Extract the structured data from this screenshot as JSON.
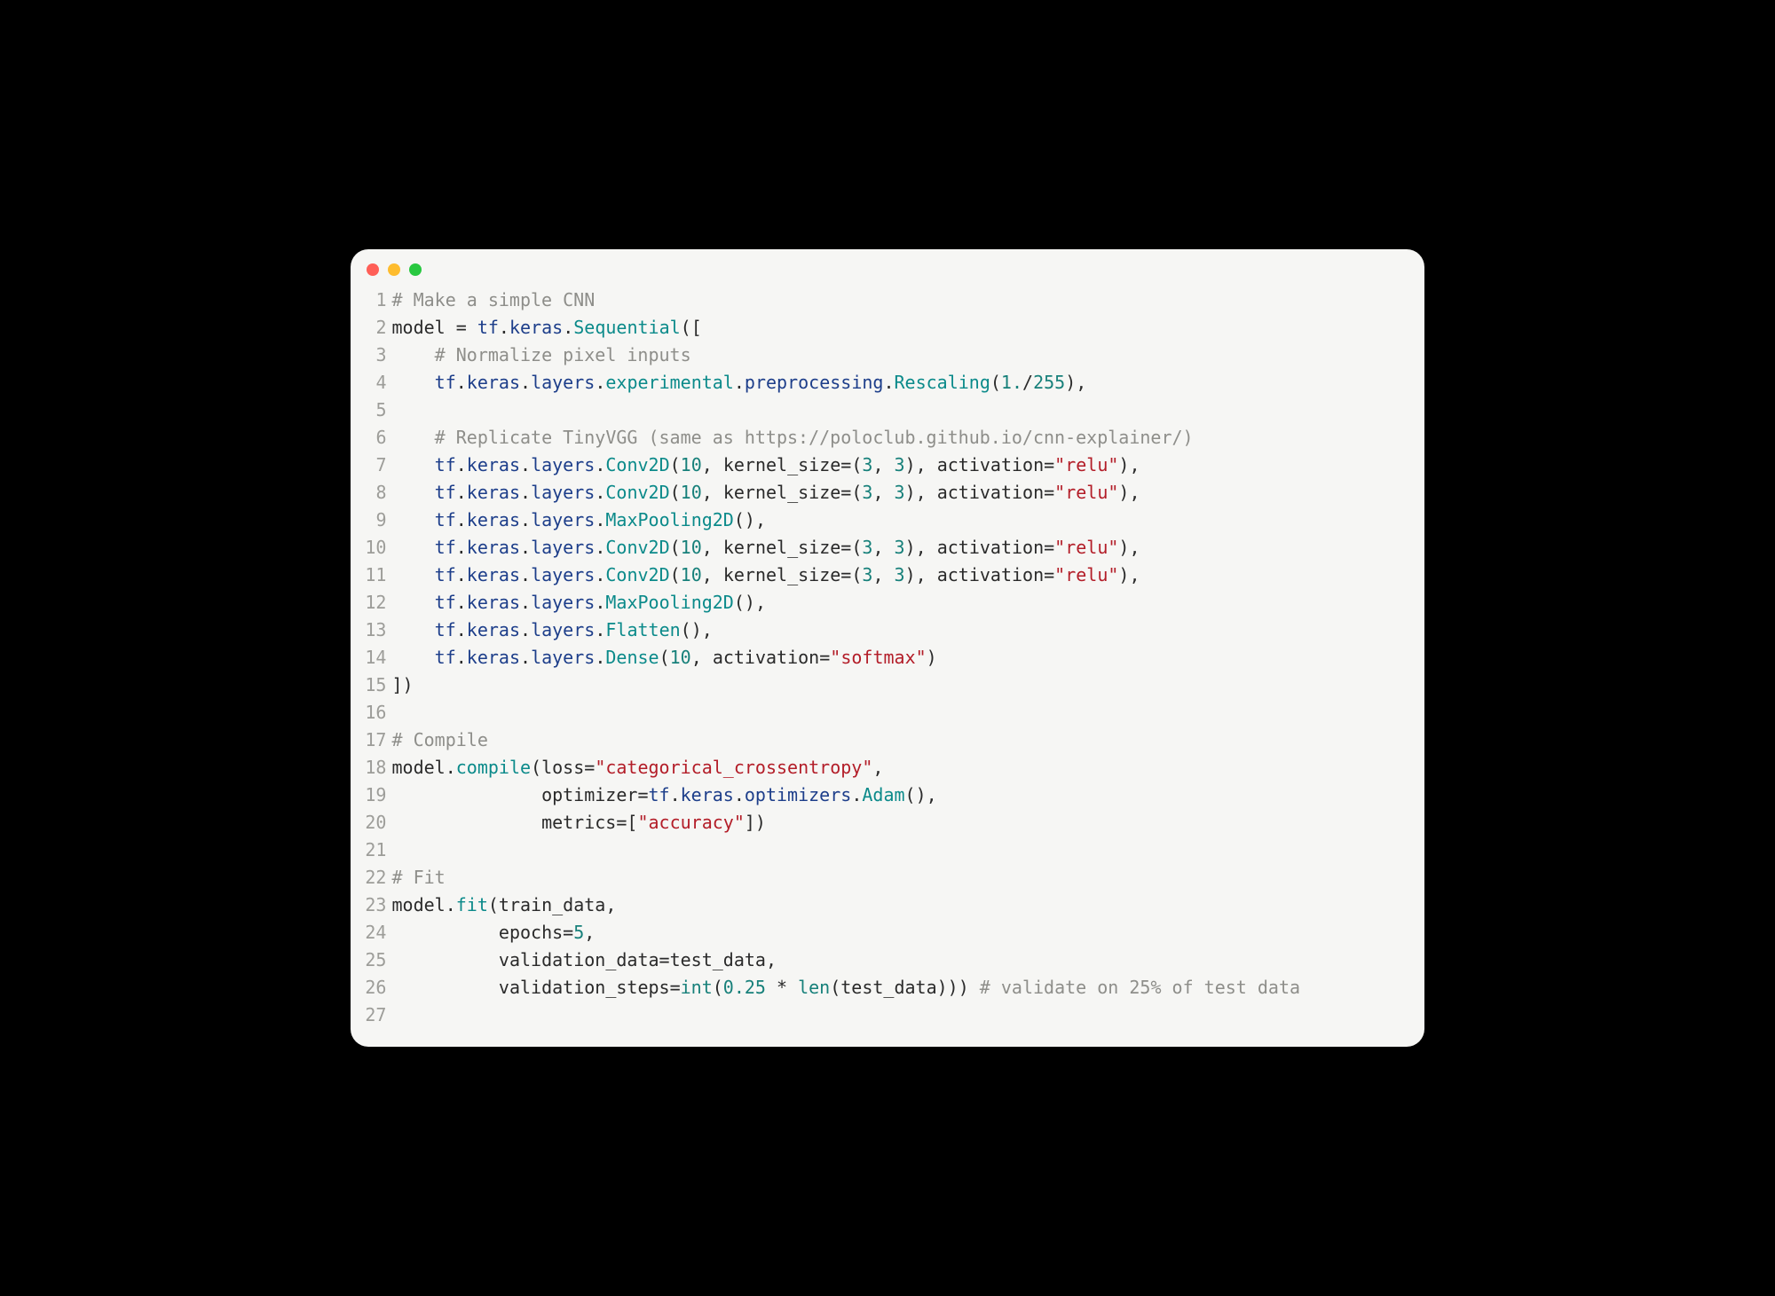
{
  "colors": {
    "background_page": "#000000",
    "window_background": "#f6f6f4",
    "gutter": "#9d9d99",
    "comment": "#8e8e8a",
    "keyword_blue": "#1d3e8a",
    "method_teal": "#0b8a8a",
    "number_teal": "#17807a",
    "string_red": "#b31d28",
    "text": "#2a2a2a",
    "dot_red": "#ff5f57",
    "dot_yellow": "#febc2e",
    "dot_green": "#28c840"
  },
  "titlebar": {
    "dots": [
      "red",
      "yellow",
      "green"
    ]
  },
  "code_lines": [
    {
      "n": 1,
      "tokens": [
        {
          "cls": "c-comment",
          "t": "# Make a simple CNN"
        }
      ]
    },
    {
      "n": 2,
      "tokens": [
        {
          "cls": "c-id",
          "t": "model "
        },
        {
          "cls": "c-op",
          "t": "= "
        },
        {
          "cls": "c-kw",
          "t": "tf"
        },
        {
          "cls": "c-punc",
          "t": "."
        },
        {
          "cls": "c-kw",
          "t": "keras"
        },
        {
          "cls": "c-punc",
          "t": "."
        },
        {
          "cls": "c-func",
          "t": "Sequential"
        },
        {
          "cls": "c-punc",
          "t": "(["
        }
      ]
    },
    {
      "n": 3,
      "tokens": [
        {
          "cls": "c-id",
          "t": "    "
        },
        {
          "cls": "c-comment",
          "t": "# Normalize pixel inputs"
        }
      ]
    },
    {
      "n": 4,
      "tokens": [
        {
          "cls": "c-id",
          "t": "    "
        },
        {
          "cls": "c-kw",
          "t": "tf"
        },
        {
          "cls": "c-punc",
          "t": "."
        },
        {
          "cls": "c-kw",
          "t": "keras"
        },
        {
          "cls": "c-punc",
          "t": "."
        },
        {
          "cls": "c-kw",
          "t": "layers"
        },
        {
          "cls": "c-punc",
          "t": "."
        },
        {
          "cls": "c-func",
          "t": "experimental"
        },
        {
          "cls": "c-punc",
          "t": "."
        },
        {
          "cls": "c-kw",
          "t": "preprocessing"
        },
        {
          "cls": "c-punc",
          "t": "."
        },
        {
          "cls": "c-func",
          "t": "Rescaling"
        },
        {
          "cls": "c-punc",
          "t": "("
        },
        {
          "cls": "c-num",
          "t": "1."
        },
        {
          "cls": "c-op",
          "t": "/"
        },
        {
          "cls": "c-num",
          "t": "255"
        },
        {
          "cls": "c-punc",
          "t": "),"
        }
      ]
    },
    {
      "n": 5,
      "tokens": [
        {
          "cls": "c-id",
          "t": ""
        }
      ]
    },
    {
      "n": 6,
      "tokens": [
        {
          "cls": "c-id",
          "t": "    "
        },
        {
          "cls": "c-comment",
          "t": "# Replicate TinyVGG (same as https://poloclub.github.io/cnn-explainer/)"
        }
      ]
    },
    {
      "n": 7,
      "tokens": [
        {
          "cls": "c-id",
          "t": "    "
        },
        {
          "cls": "c-kw",
          "t": "tf"
        },
        {
          "cls": "c-punc",
          "t": "."
        },
        {
          "cls": "c-kw",
          "t": "keras"
        },
        {
          "cls": "c-punc",
          "t": "."
        },
        {
          "cls": "c-kw",
          "t": "layers"
        },
        {
          "cls": "c-punc",
          "t": "."
        },
        {
          "cls": "c-func",
          "t": "Conv2D"
        },
        {
          "cls": "c-punc",
          "t": "("
        },
        {
          "cls": "c-num",
          "t": "10"
        },
        {
          "cls": "c-punc",
          "t": ", "
        },
        {
          "cls": "c-param",
          "t": "kernel_size"
        },
        {
          "cls": "c-op",
          "t": "="
        },
        {
          "cls": "c-punc",
          "t": "("
        },
        {
          "cls": "c-num",
          "t": "3"
        },
        {
          "cls": "c-punc",
          "t": ", "
        },
        {
          "cls": "c-num",
          "t": "3"
        },
        {
          "cls": "c-punc",
          "t": "), "
        },
        {
          "cls": "c-param",
          "t": "activation"
        },
        {
          "cls": "c-op",
          "t": "="
        },
        {
          "cls": "c-str",
          "t": "\"relu\""
        },
        {
          "cls": "c-punc",
          "t": "),"
        }
      ]
    },
    {
      "n": 8,
      "tokens": [
        {
          "cls": "c-id",
          "t": "    "
        },
        {
          "cls": "c-kw",
          "t": "tf"
        },
        {
          "cls": "c-punc",
          "t": "."
        },
        {
          "cls": "c-kw",
          "t": "keras"
        },
        {
          "cls": "c-punc",
          "t": "."
        },
        {
          "cls": "c-kw",
          "t": "layers"
        },
        {
          "cls": "c-punc",
          "t": "."
        },
        {
          "cls": "c-func",
          "t": "Conv2D"
        },
        {
          "cls": "c-punc",
          "t": "("
        },
        {
          "cls": "c-num",
          "t": "10"
        },
        {
          "cls": "c-punc",
          "t": ", "
        },
        {
          "cls": "c-param",
          "t": "kernel_size"
        },
        {
          "cls": "c-op",
          "t": "="
        },
        {
          "cls": "c-punc",
          "t": "("
        },
        {
          "cls": "c-num",
          "t": "3"
        },
        {
          "cls": "c-punc",
          "t": ", "
        },
        {
          "cls": "c-num",
          "t": "3"
        },
        {
          "cls": "c-punc",
          "t": "), "
        },
        {
          "cls": "c-param",
          "t": "activation"
        },
        {
          "cls": "c-op",
          "t": "="
        },
        {
          "cls": "c-str",
          "t": "\"relu\""
        },
        {
          "cls": "c-punc",
          "t": "),"
        }
      ]
    },
    {
      "n": 9,
      "tokens": [
        {
          "cls": "c-id",
          "t": "    "
        },
        {
          "cls": "c-kw",
          "t": "tf"
        },
        {
          "cls": "c-punc",
          "t": "."
        },
        {
          "cls": "c-kw",
          "t": "keras"
        },
        {
          "cls": "c-punc",
          "t": "."
        },
        {
          "cls": "c-kw",
          "t": "layers"
        },
        {
          "cls": "c-punc",
          "t": "."
        },
        {
          "cls": "c-func",
          "t": "MaxPooling2D"
        },
        {
          "cls": "c-punc",
          "t": "(),"
        }
      ]
    },
    {
      "n": 10,
      "tokens": [
        {
          "cls": "c-id",
          "t": "    "
        },
        {
          "cls": "c-kw",
          "t": "tf"
        },
        {
          "cls": "c-punc",
          "t": "."
        },
        {
          "cls": "c-kw",
          "t": "keras"
        },
        {
          "cls": "c-punc",
          "t": "."
        },
        {
          "cls": "c-kw",
          "t": "layers"
        },
        {
          "cls": "c-punc",
          "t": "."
        },
        {
          "cls": "c-func",
          "t": "Conv2D"
        },
        {
          "cls": "c-punc",
          "t": "("
        },
        {
          "cls": "c-num",
          "t": "10"
        },
        {
          "cls": "c-punc",
          "t": ", "
        },
        {
          "cls": "c-param",
          "t": "kernel_size"
        },
        {
          "cls": "c-op",
          "t": "="
        },
        {
          "cls": "c-punc",
          "t": "("
        },
        {
          "cls": "c-num",
          "t": "3"
        },
        {
          "cls": "c-punc",
          "t": ", "
        },
        {
          "cls": "c-num",
          "t": "3"
        },
        {
          "cls": "c-punc",
          "t": "), "
        },
        {
          "cls": "c-param",
          "t": "activation"
        },
        {
          "cls": "c-op",
          "t": "="
        },
        {
          "cls": "c-str",
          "t": "\"relu\""
        },
        {
          "cls": "c-punc",
          "t": "),"
        }
      ]
    },
    {
      "n": 11,
      "tokens": [
        {
          "cls": "c-id",
          "t": "    "
        },
        {
          "cls": "c-kw",
          "t": "tf"
        },
        {
          "cls": "c-punc",
          "t": "."
        },
        {
          "cls": "c-kw",
          "t": "keras"
        },
        {
          "cls": "c-punc",
          "t": "."
        },
        {
          "cls": "c-kw",
          "t": "layers"
        },
        {
          "cls": "c-punc",
          "t": "."
        },
        {
          "cls": "c-func",
          "t": "Conv2D"
        },
        {
          "cls": "c-punc",
          "t": "("
        },
        {
          "cls": "c-num",
          "t": "10"
        },
        {
          "cls": "c-punc",
          "t": ", "
        },
        {
          "cls": "c-param",
          "t": "kernel_size"
        },
        {
          "cls": "c-op",
          "t": "="
        },
        {
          "cls": "c-punc",
          "t": "("
        },
        {
          "cls": "c-num",
          "t": "3"
        },
        {
          "cls": "c-punc",
          "t": ", "
        },
        {
          "cls": "c-num",
          "t": "3"
        },
        {
          "cls": "c-punc",
          "t": "), "
        },
        {
          "cls": "c-param",
          "t": "activation"
        },
        {
          "cls": "c-op",
          "t": "="
        },
        {
          "cls": "c-str",
          "t": "\"relu\""
        },
        {
          "cls": "c-punc",
          "t": "),"
        }
      ]
    },
    {
      "n": 12,
      "tokens": [
        {
          "cls": "c-id",
          "t": "    "
        },
        {
          "cls": "c-kw",
          "t": "tf"
        },
        {
          "cls": "c-punc",
          "t": "."
        },
        {
          "cls": "c-kw",
          "t": "keras"
        },
        {
          "cls": "c-punc",
          "t": "."
        },
        {
          "cls": "c-kw",
          "t": "layers"
        },
        {
          "cls": "c-punc",
          "t": "."
        },
        {
          "cls": "c-func",
          "t": "MaxPooling2D"
        },
        {
          "cls": "c-punc",
          "t": "(),"
        }
      ]
    },
    {
      "n": 13,
      "tokens": [
        {
          "cls": "c-id",
          "t": "    "
        },
        {
          "cls": "c-kw",
          "t": "tf"
        },
        {
          "cls": "c-punc",
          "t": "."
        },
        {
          "cls": "c-kw",
          "t": "keras"
        },
        {
          "cls": "c-punc",
          "t": "."
        },
        {
          "cls": "c-kw",
          "t": "layers"
        },
        {
          "cls": "c-punc",
          "t": "."
        },
        {
          "cls": "c-func",
          "t": "Flatten"
        },
        {
          "cls": "c-punc",
          "t": "(),"
        }
      ]
    },
    {
      "n": 14,
      "tokens": [
        {
          "cls": "c-id",
          "t": "    "
        },
        {
          "cls": "c-kw",
          "t": "tf"
        },
        {
          "cls": "c-punc",
          "t": "."
        },
        {
          "cls": "c-kw",
          "t": "keras"
        },
        {
          "cls": "c-punc",
          "t": "."
        },
        {
          "cls": "c-kw",
          "t": "layers"
        },
        {
          "cls": "c-punc",
          "t": "."
        },
        {
          "cls": "c-func",
          "t": "Dense"
        },
        {
          "cls": "c-punc",
          "t": "("
        },
        {
          "cls": "c-num",
          "t": "10"
        },
        {
          "cls": "c-punc",
          "t": ", "
        },
        {
          "cls": "c-param",
          "t": "activation"
        },
        {
          "cls": "c-op",
          "t": "="
        },
        {
          "cls": "c-str",
          "t": "\"softmax\""
        },
        {
          "cls": "c-punc",
          "t": ")"
        }
      ]
    },
    {
      "n": 15,
      "tokens": [
        {
          "cls": "c-punc",
          "t": "])"
        }
      ]
    },
    {
      "n": 16,
      "tokens": [
        {
          "cls": "c-id",
          "t": ""
        }
      ]
    },
    {
      "n": 17,
      "tokens": [
        {
          "cls": "c-comment",
          "t": "# Compile"
        }
      ]
    },
    {
      "n": 18,
      "tokens": [
        {
          "cls": "c-id",
          "t": "model"
        },
        {
          "cls": "c-punc",
          "t": "."
        },
        {
          "cls": "c-func",
          "t": "compile"
        },
        {
          "cls": "c-punc",
          "t": "("
        },
        {
          "cls": "c-param",
          "t": "loss"
        },
        {
          "cls": "c-op",
          "t": "="
        },
        {
          "cls": "c-str",
          "t": "\"categorical_crossentropy\""
        },
        {
          "cls": "c-punc",
          "t": ","
        }
      ]
    },
    {
      "n": 19,
      "tokens": [
        {
          "cls": "c-id",
          "t": "              "
        },
        {
          "cls": "c-param",
          "t": "optimizer"
        },
        {
          "cls": "c-op",
          "t": "="
        },
        {
          "cls": "c-kw",
          "t": "tf"
        },
        {
          "cls": "c-punc",
          "t": "."
        },
        {
          "cls": "c-kw",
          "t": "keras"
        },
        {
          "cls": "c-punc",
          "t": "."
        },
        {
          "cls": "c-kw",
          "t": "optimizers"
        },
        {
          "cls": "c-punc",
          "t": "."
        },
        {
          "cls": "c-func",
          "t": "Adam"
        },
        {
          "cls": "c-punc",
          "t": "(),"
        }
      ]
    },
    {
      "n": 20,
      "tokens": [
        {
          "cls": "c-id",
          "t": "              "
        },
        {
          "cls": "c-param",
          "t": "metrics"
        },
        {
          "cls": "c-op",
          "t": "="
        },
        {
          "cls": "c-punc",
          "t": "["
        },
        {
          "cls": "c-str",
          "t": "\"accuracy\""
        },
        {
          "cls": "c-punc",
          "t": "])"
        }
      ]
    },
    {
      "n": 21,
      "tokens": [
        {
          "cls": "c-id",
          "t": ""
        }
      ]
    },
    {
      "n": 22,
      "tokens": [
        {
          "cls": "c-comment",
          "t": "# Fit"
        }
      ]
    },
    {
      "n": 23,
      "tokens": [
        {
          "cls": "c-id",
          "t": "model"
        },
        {
          "cls": "c-punc",
          "t": "."
        },
        {
          "cls": "c-func",
          "t": "fit"
        },
        {
          "cls": "c-punc",
          "t": "("
        },
        {
          "cls": "c-id",
          "t": "train_data"
        },
        {
          "cls": "c-punc",
          "t": ","
        }
      ]
    },
    {
      "n": 24,
      "tokens": [
        {
          "cls": "c-id",
          "t": "          "
        },
        {
          "cls": "c-param",
          "t": "epochs"
        },
        {
          "cls": "c-op",
          "t": "="
        },
        {
          "cls": "c-num",
          "t": "5"
        },
        {
          "cls": "c-punc",
          "t": ","
        }
      ]
    },
    {
      "n": 25,
      "tokens": [
        {
          "cls": "c-id",
          "t": "          "
        },
        {
          "cls": "c-param",
          "t": "validation_data"
        },
        {
          "cls": "c-op",
          "t": "="
        },
        {
          "cls": "c-id",
          "t": "test_data"
        },
        {
          "cls": "c-punc",
          "t": ","
        }
      ]
    },
    {
      "n": 26,
      "tokens": [
        {
          "cls": "c-id",
          "t": "          "
        },
        {
          "cls": "c-param",
          "t": "validation_steps"
        },
        {
          "cls": "c-op",
          "t": "="
        },
        {
          "cls": "c-builtin",
          "t": "int"
        },
        {
          "cls": "c-punc",
          "t": "("
        },
        {
          "cls": "c-num",
          "t": "0.25"
        },
        {
          "cls": "c-op",
          "t": " * "
        },
        {
          "cls": "c-builtin",
          "t": "len"
        },
        {
          "cls": "c-punc",
          "t": "("
        },
        {
          "cls": "c-id",
          "t": "test_data"
        },
        {
          "cls": "c-punc",
          "t": "))) "
        },
        {
          "cls": "c-comment",
          "t": "# validate on 25% of test data"
        }
      ]
    },
    {
      "n": 27,
      "tokens": [
        {
          "cls": "c-id",
          "t": ""
        }
      ]
    }
  ]
}
